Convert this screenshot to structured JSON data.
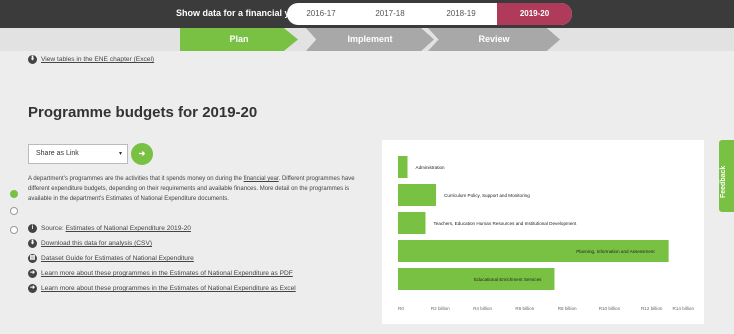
{
  "topbar": {
    "label": "Show data for a financial year",
    "years": [
      "2016-17",
      "2017-18",
      "2018-19",
      "2019-20"
    ],
    "active_year": "2019-20"
  },
  "stages": [
    "Plan",
    "Implement",
    "Review"
  ],
  "ene_link": "View tables in the ENE chapter (Excel)",
  "title": "Programme budgets for 2019-20",
  "share": {
    "label": "Share as Link",
    "caret": "▾",
    "go": "Go"
  },
  "description": {
    "part1": "A department's programmes are the activities that it spends money on during the ",
    "link": "financial year",
    "part2": ". Different programmes have different expenditure budgets, depending on their requirements and available finances. More detail on the programmes is available in the department's Estimates of National Expenditure documents."
  },
  "links": [
    {
      "prefix": "Source: ",
      "text": "Estimates of National Expenditure 2019-20"
    },
    {
      "prefix": "",
      "text": "Download this data for analysis (CSV)"
    },
    {
      "prefix": "",
      "text": "Dataset Guide for Estimates of National Expenditure"
    },
    {
      "prefix": "",
      "text": "Learn more about these programmes in the Estimates of National Expenditure as PDF"
    },
    {
      "prefix": "",
      "text": "Learn more about these programmes in the Estimates of National Expenditure as Excel"
    }
  ],
  "feedback": "Feedback",
  "colors": {
    "accent": "#79c143",
    "active_year": "#b03a5a",
    "topbar": "#3b3b3b"
  },
  "chart_data": {
    "type": "bar",
    "orientation": "horizontal",
    "categories": [
      "Administration",
      "Curriculum Policy, Support and Monitoring",
      "Teachers, Education Human Resources and Institutional Development",
      "Planning, Information and Assessment",
      "Educational Enrichment Services"
    ],
    "values": [
      0.45,
      1.8,
      1.3,
      12.8,
      7.4
    ],
    "xlim": [
      0,
      14
    ],
    "tick_values": [
      0,
      2,
      4,
      6,
      8,
      10,
      12,
      14
    ],
    "tick_labels": [
      "R0",
      "R2 billion",
      "R4 billion",
      "R6 billion",
      "R8 billion",
      "R10 billion",
      "R12 billion",
      "R14 billion"
    ],
    "grid": false
  }
}
